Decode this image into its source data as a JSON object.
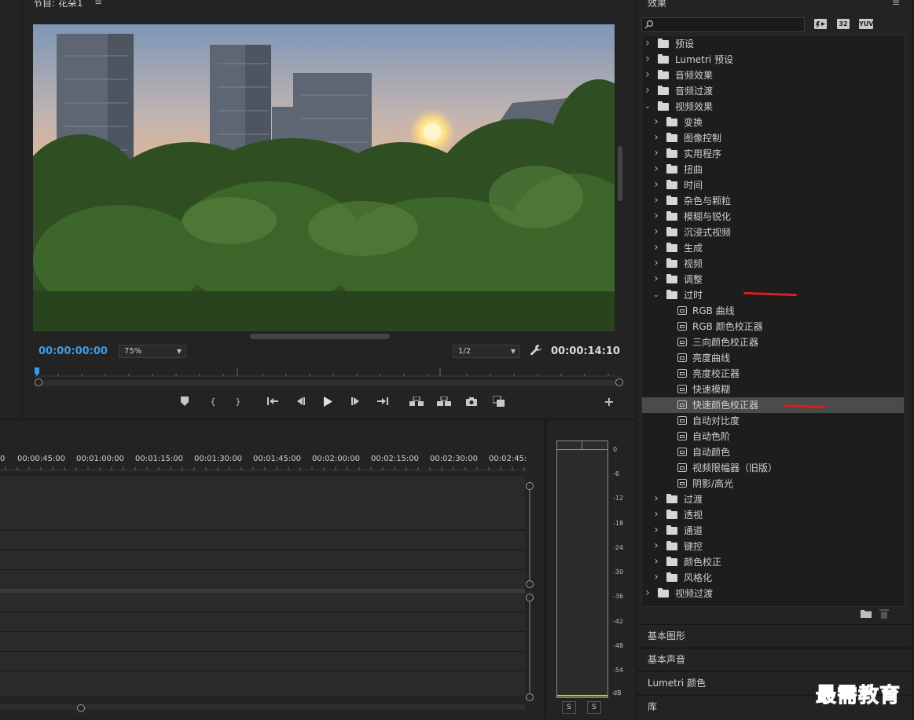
{
  "program_monitor": {
    "title": "节目: 花朵1",
    "menu_icon": "≡",
    "current_timecode": "00:00:00:00",
    "duration_timecode": "00:00:14:10",
    "zoom": "75%",
    "quality": "1/2",
    "accent_color": "#3d9be9"
  },
  "timeline": {
    "ruler_labels": [
      "0",
      "00:00:45:00",
      "00:01:00:00",
      "00:01:15:00",
      "00:01:30:00",
      "00:01:45:00",
      "00:02:00:00",
      "00:02:15:00",
      "00:02:30:00",
      "00:02:45:"
    ]
  },
  "audio_meter": {
    "db_labels": [
      "0",
      "-6",
      "-12",
      "-18",
      "-24",
      "-30",
      "-36",
      "-42",
      "-48",
      "-54",
      "dB"
    ],
    "solo_left": "S",
    "solo_right": "S"
  },
  "effects": {
    "title": "效果",
    "menu_icon": "≡",
    "badges": [
      "32",
      "YUV"
    ],
    "tree": [
      {
        "label": "预设",
        "level": 0,
        "type": "preset-folder",
        "expanded": false
      },
      {
        "label": "Lumetri 预设",
        "level": 0,
        "type": "preset-folder",
        "expanded": false
      },
      {
        "label": "音频效果",
        "level": 0,
        "type": "folder",
        "expanded": false
      },
      {
        "label": "音频过渡",
        "level": 0,
        "type": "folder",
        "expanded": false
      },
      {
        "label": "视频效果",
        "level": 0,
        "type": "folder",
        "expanded": true
      },
      {
        "label": "变换",
        "level": 1,
        "type": "folder",
        "expanded": false
      },
      {
        "label": "图像控制",
        "level": 1,
        "type": "folder",
        "expanded": false
      },
      {
        "label": "实用程序",
        "level": 1,
        "type": "folder",
        "expanded": false
      },
      {
        "label": "扭曲",
        "level": 1,
        "type": "folder",
        "expanded": false
      },
      {
        "label": "时间",
        "level": 1,
        "type": "folder",
        "expanded": false
      },
      {
        "label": "杂色与颗粒",
        "level": 1,
        "type": "folder",
        "expanded": false
      },
      {
        "label": "模糊与锐化",
        "level": 1,
        "type": "folder",
        "expanded": false
      },
      {
        "label": "沉浸式视频",
        "level": 1,
        "type": "folder",
        "expanded": false
      },
      {
        "label": "生成",
        "level": 1,
        "type": "folder",
        "expanded": false
      },
      {
        "label": "视频",
        "level": 1,
        "type": "folder",
        "expanded": false
      },
      {
        "label": "调整",
        "level": 1,
        "type": "folder",
        "expanded": false
      },
      {
        "label": "过时",
        "level": 1,
        "type": "folder",
        "expanded": true
      },
      {
        "label": "RGB 曲线",
        "level": 2,
        "type": "effect"
      },
      {
        "label": "RGB 颜色校正器",
        "level": 2,
        "type": "effect"
      },
      {
        "label": "三向颜色校正器",
        "level": 2,
        "type": "effect"
      },
      {
        "label": "亮度曲线",
        "level": 2,
        "type": "effect"
      },
      {
        "label": "亮度校正器",
        "level": 2,
        "type": "effect"
      },
      {
        "label": "快速模糊",
        "level": 2,
        "type": "effect"
      },
      {
        "label": "快速颜色校正器",
        "level": 2,
        "type": "effect",
        "selected": true
      },
      {
        "label": "自动对比度",
        "level": 2,
        "type": "effect"
      },
      {
        "label": "自动色阶",
        "level": 2,
        "type": "effect"
      },
      {
        "label": "自动颜色",
        "level": 2,
        "type": "effect"
      },
      {
        "label": "视频限幅器（旧版）",
        "level": 2,
        "type": "effect"
      },
      {
        "label": "阴影/高光",
        "level": 2,
        "type": "effect"
      },
      {
        "label": "过渡",
        "level": 1,
        "type": "folder",
        "expanded": false
      },
      {
        "label": "透视",
        "level": 1,
        "type": "folder",
        "expanded": false
      },
      {
        "label": "通道",
        "level": 1,
        "type": "folder",
        "expanded": false
      },
      {
        "label": "键控",
        "level": 1,
        "type": "folder",
        "expanded": false
      },
      {
        "label": "颜色校正",
        "level": 1,
        "type": "folder",
        "expanded": false
      },
      {
        "label": "风格化",
        "level": 1,
        "type": "folder",
        "expanded": false
      },
      {
        "label": "视频过渡",
        "level": 0,
        "type": "folder",
        "expanded": false
      }
    ]
  },
  "collapsed_panels": {
    "essential_graphics": "基本图形",
    "essential_sound": "基本声音",
    "lumetri_color": "Lumetri 颜色",
    "libraries": "库"
  },
  "watermark": "最需教育"
}
